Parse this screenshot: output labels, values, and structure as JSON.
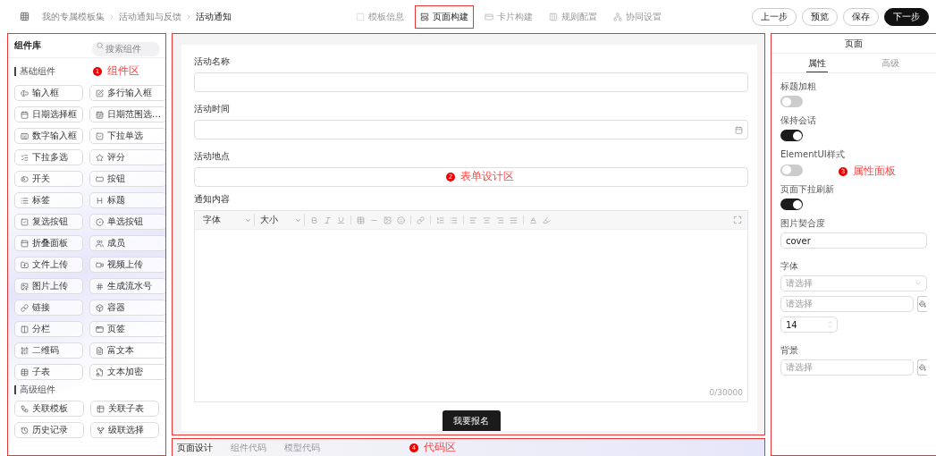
{
  "breadcrumb": [
    "我的专属模板集",
    "活动通知与反馈",
    "活动通知"
  ],
  "steps": [
    {
      "label": "模板信息",
      "selected": false
    },
    {
      "label": "页面构建",
      "selected": true
    },
    {
      "label": "卡片构建",
      "selected": false
    },
    {
      "label": "规则配置",
      "selected": false
    },
    {
      "label": "协同设置",
      "selected": false
    }
  ],
  "buttons": [
    {
      "label": "上一步",
      "kind": "outline"
    },
    {
      "label": "预览",
      "kind": "outline"
    },
    {
      "label": "保存",
      "kind": "outline"
    },
    {
      "label": "下一步",
      "kind": "primary"
    }
  ],
  "library": {
    "title": "组件库",
    "search": {
      "placeholder": "搜索组件"
    },
    "annotation": {
      "number": "1",
      "label": "组件区"
    },
    "groups": [
      {
        "title": "基础组件",
        "items": [
          "输入框",
          "多行输入框",
          "日期选择框",
          "日期范围选…",
          "数字输入框",
          "下拉单选",
          "下拉多选",
          "评分",
          "开关",
          "按钮",
          "标签",
          "标题",
          "复选按钮",
          "单选按钮",
          "折叠面板",
          "成员",
          "文件上传",
          "视频上传",
          "图片上传",
          "生成流水号",
          "链接",
          "容器",
          "分栏",
          "页签",
          "二维码",
          "富文本",
          "子表",
          "文本加密"
        ]
      },
      {
        "title": "高级组件",
        "items": [
          "关联模板",
          "关联子表",
          "历史记录",
          "级联选择"
        ]
      }
    ]
  },
  "form": {
    "annotation": {
      "number": "2",
      "label": "表单设计区"
    },
    "fields": [
      {
        "label": "活动名称",
        "kind": "text"
      },
      {
        "label": "活动时间",
        "kind": "date"
      },
      {
        "label": "活动地点",
        "kind": "text"
      }
    ],
    "editor": {
      "label": "通知内容",
      "font": "字体",
      "size": "大小",
      "counter": "0/30000"
    },
    "submit": "我要报名"
  },
  "code": {
    "annotation": {
      "number": "4",
      "label": "代码区"
    },
    "tabs": [
      {
        "label": "页面设计",
        "selected": true
      },
      {
        "label": "组件代码",
        "selected": false
      },
      {
        "label": "模型代码",
        "selected": false
      }
    ]
  },
  "props": {
    "title": "页面",
    "annotation": {
      "number": "3",
      "label": "属性面板"
    },
    "tabs": [
      {
        "label": "属性",
        "selected": true
      },
      {
        "label": "高级",
        "selected": false
      }
    ],
    "switches": [
      {
        "label": "标题加粗",
        "on": false
      },
      {
        "label": "保持会话",
        "on": true
      },
      {
        "label": "ElementUI样式",
        "on": false
      },
      {
        "label": "页面下拉刷新",
        "on": true
      }
    ],
    "fit": {
      "label": "图片契合度",
      "value": "cover"
    },
    "font": {
      "label": "字体",
      "select_placeholder": "请选择",
      "color_placeholder": "请选择",
      "size": "14"
    },
    "background": {
      "label": "背景",
      "placeholder": "请选择"
    }
  }
}
